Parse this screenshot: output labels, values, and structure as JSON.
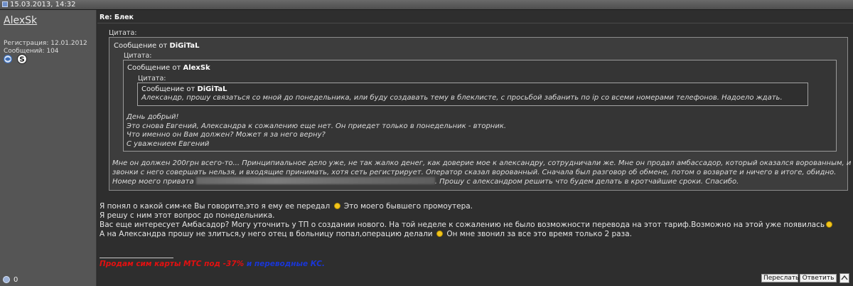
{
  "topbar": {
    "datetime": "15.03.2013, 14:32",
    "icon": "post-icon"
  },
  "user": {
    "name": "AlexSk",
    "reg_label": "Регистрация: 12.01.2012",
    "posts_label": "Сообщений: 104",
    "status_icon": "user-status-icon",
    "skype_icon": "skype-icon"
  },
  "post": {
    "subject": "Re: Блек",
    "quote1": {
      "label": "Цитата:",
      "from_prefix": "Сообщение от ",
      "author": "DiGiTaL",
      "quote2": {
        "label": "Цитата:",
        "from_prefix": "Сообщение от ",
        "author": "AlexSk",
        "quote3": {
          "label": "Цитата:",
          "from_prefix": "Сообщение от ",
          "author": "DiGiTaL",
          "text": "Александр, прошу связаться со мной до понедельника, или буду создавать тему в блеклисте, с просьбой забанить по ip со всеми номерами телефонов. Надоело ждать."
        },
        "lines": [
          "День добрый!",
          "Это снова Евгений, Александра к сожалению еще нет. Он приедет только в понедельник - вторник.",
          "Что именно он Вам должен? Может я за него верну?",
          "С уважением Евгений"
        ]
      },
      "lines": [
        "Мне он должен 200грн всего-то... Принципиальное дело уже, не так жалко денег, как доверие мое к александру, сотрудничали же. Мне он продал амбассадор, который оказался ворованным, и",
        "звонки с него совершать нельзя, и входящие принимать, хотя сеть регистрирует. Оператор сказал ворованный. Сначала был разговор об обмене, потом о возврате и ничего в итоге, обидно.",
        "Номер моего привата",
        ". Прошу с александром решить что будем делать в кротчайшие сроки. Спасибо."
      ]
    },
    "body": {
      "l1a": "Я понял о какой сим-ке Вы говорите,это я ему ее передал",
      "l1b": "Это моего бывшего промоутера.",
      "l2": "Я решу с ним этот вопрос до понедельника.",
      "l3": "Вас еще интересует Амбасадор? Могу уточнить у ТП о создании нового. На той неделе к сожалению не было возможности перевода на этот тариф.Возможно на этой уже появилась",
      "l4a": "А на Александра прошу не злиться,у него отец в больницу попал,операцию делали",
      "l4b": "Он мне звонил за все это время только 2 раза."
    },
    "signature": {
      "red": "Продам сим карты МТС под -37%",
      "blue": " и переводные КС.",
      "red_color": "#e31010",
      "blue_color": "#1a36d6"
    },
    "buttons": {
      "forward": "Переслать",
      "reply": "Ответить"
    },
    "footer_icon_count": "0"
  }
}
